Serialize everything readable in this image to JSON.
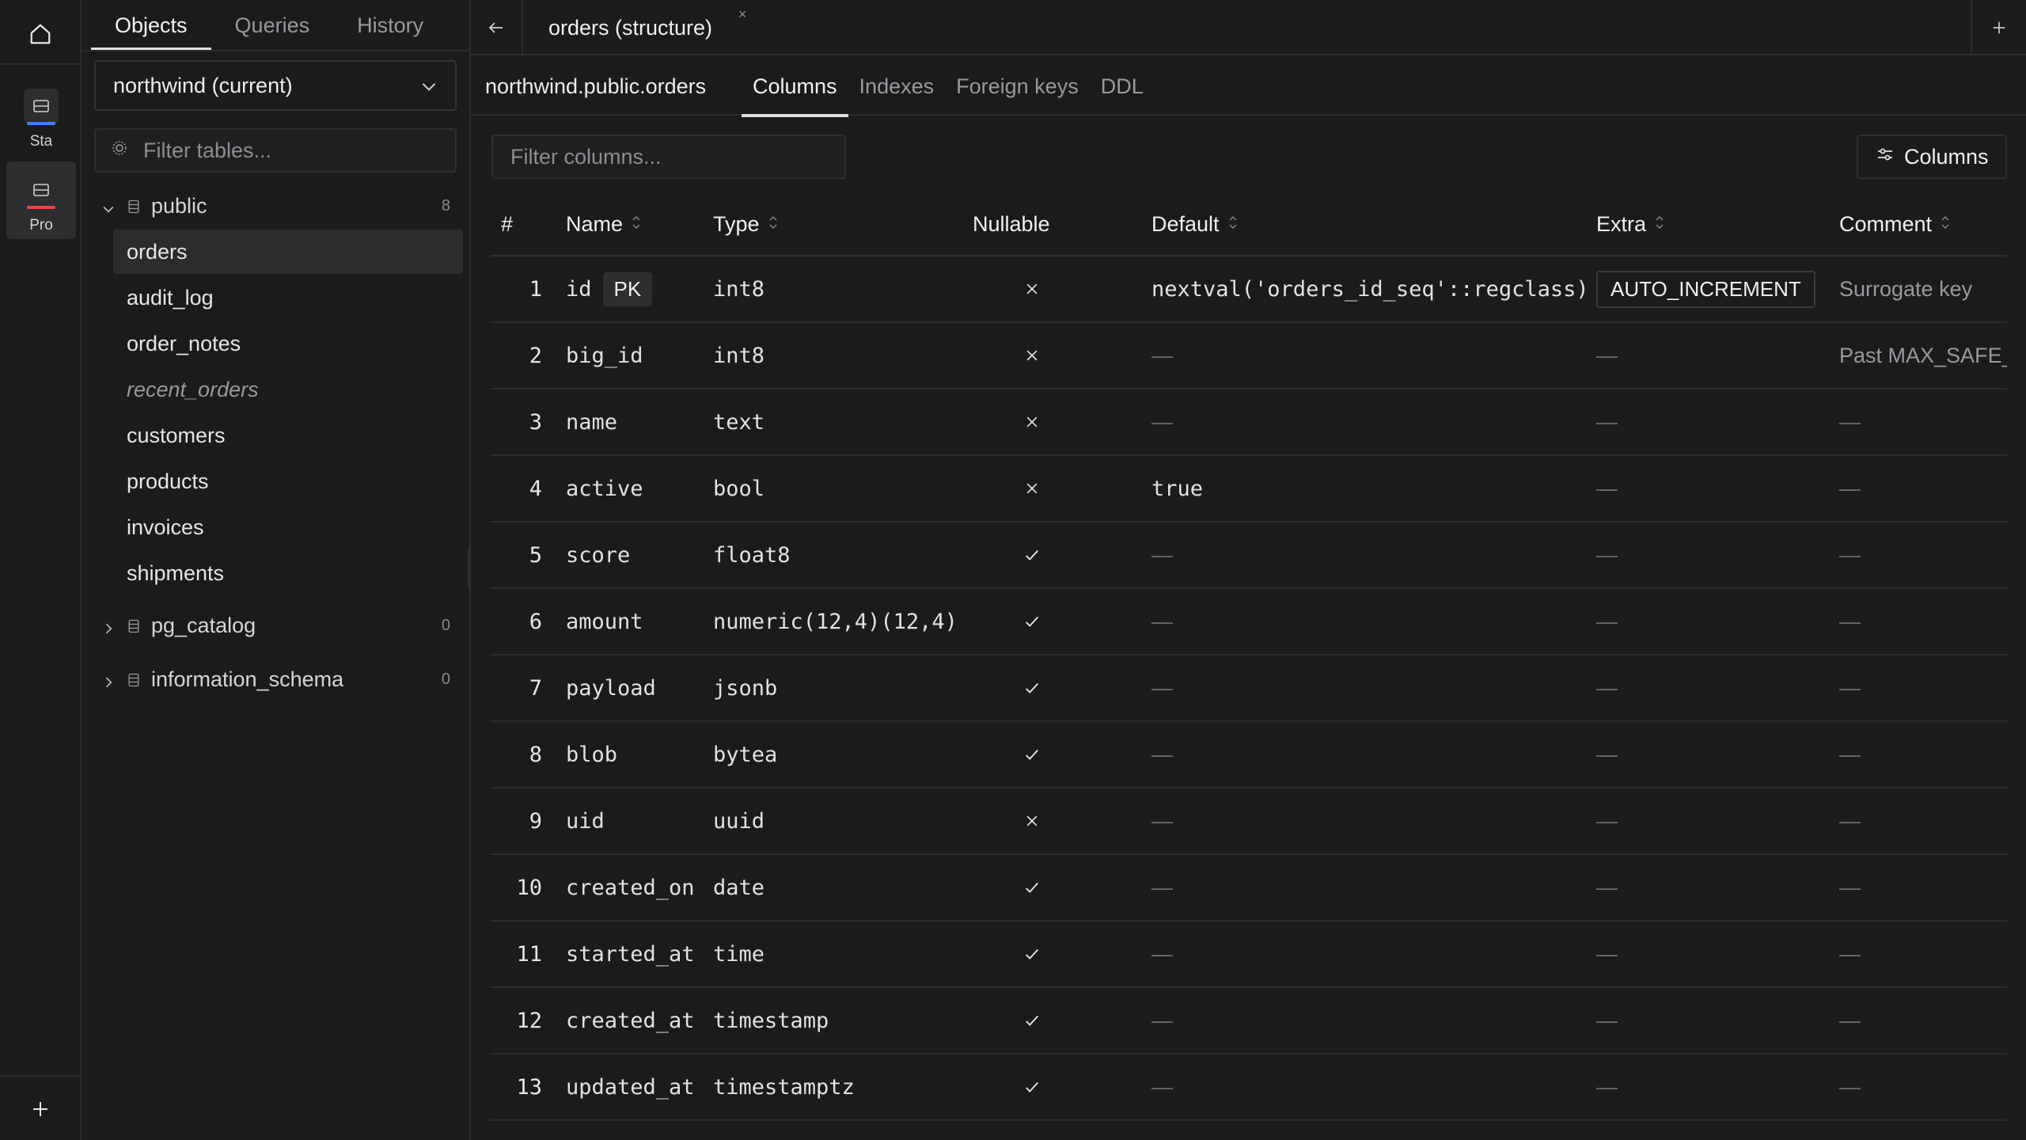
{
  "rail": {
    "connections": [
      {
        "label": "Sta",
        "bar_color": "#3b82f6"
      },
      {
        "label": "Pro",
        "bar_color": "#ef4444"
      }
    ]
  },
  "sidebar": {
    "tabs": [
      "Objects",
      "Queries",
      "History"
    ],
    "active_tab": 0,
    "database": "northwind (current)",
    "filter_placeholder": "Filter tables...",
    "schemas": [
      {
        "name": "public",
        "count": "8",
        "expanded": true,
        "tables": [
          {
            "name": "orders",
            "selected": true,
            "view": false
          },
          {
            "name": "audit_log",
            "selected": false,
            "view": false
          },
          {
            "name": "order_notes",
            "selected": false,
            "view": false
          },
          {
            "name": "recent_orders",
            "selected": false,
            "view": true
          },
          {
            "name": "customers",
            "selected": false,
            "view": false
          },
          {
            "name": "products",
            "selected": false,
            "view": false
          },
          {
            "name": "invoices",
            "selected": false,
            "view": false
          },
          {
            "name": "shipments",
            "selected": false,
            "view": false
          }
        ]
      },
      {
        "name": "pg_catalog",
        "count": "0",
        "expanded": false,
        "tables": []
      },
      {
        "name": "information_schema",
        "count": "0",
        "expanded": false,
        "tables": []
      }
    ]
  },
  "main": {
    "tab_title": "orders (structure)",
    "close_glyph": "×",
    "path": "northwind.public.orders",
    "subtabs": [
      "Columns",
      "Indexes",
      "Foreign keys",
      "DDL"
    ],
    "active_subtab": 0,
    "filter_placeholder": "Filter columns...",
    "columns_button": "Columns",
    "headers": {
      "num": "#",
      "name": "Name",
      "type": "Type",
      "nullable": "Nullable",
      "default": "Default",
      "extra": "Extra",
      "comment": "Comment"
    },
    "pk_label": "PK",
    "rows": [
      {
        "num": "1",
        "name": "id",
        "pk": true,
        "type": "int8",
        "nullable": false,
        "default": "nextval('orders_id_seq'::regclass)",
        "extra": "AUTO_INCREMENT",
        "comment": "Surrogate key"
      },
      {
        "num": "2",
        "name": "big_id",
        "pk": false,
        "type": "int8",
        "nullable": false,
        "default": "—",
        "extra": "—",
        "comment": "Past MAX_SAFE_INTE"
      },
      {
        "num": "3",
        "name": "name",
        "pk": false,
        "type": "text",
        "nullable": false,
        "default": "—",
        "extra": "—",
        "comment": "—"
      },
      {
        "num": "4",
        "name": "active",
        "pk": false,
        "type": "bool",
        "nullable": false,
        "default": "true",
        "extra": "—",
        "comment": "—"
      },
      {
        "num": "5",
        "name": "score",
        "pk": false,
        "type": "float8",
        "nullable": true,
        "default": "—",
        "extra": "—",
        "comment": "—"
      },
      {
        "num": "6",
        "name": "amount",
        "pk": false,
        "type": "numeric(12,4)(12,4)",
        "nullable": true,
        "default": "—",
        "extra": "—",
        "comment": "—"
      },
      {
        "num": "7",
        "name": "payload",
        "pk": false,
        "type": "jsonb",
        "nullable": true,
        "default": "—",
        "extra": "—",
        "comment": "—"
      },
      {
        "num": "8",
        "name": "blob",
        "pk": false,
        "type": "bytea",
        "nullable": true,
        "default": "—",
        "extra": "—",
        "comment": "—"
      },
      {
        "num": "9",
        "name": "uid",
        "pk": false,
        "type": "uuid",
        "nullable": false,
        "default": "—",
        "extra": "—",
        "comment": "—"
      },
      {
        "num": "10",
        "name": "created_on",
        "pk": false,
        "type": "date",
        "nullable": true,
        "default": "—",
        "extra": "—",
        "comment": "—"
      },
      {
        "num": "11",
        "name": "started_at",
        "pk": false,
        "type": "time",
        "nullable": true,
        "default": "—",
        "extra": "—",
        "comment": "—"
      },
      {
        "num": "12",
        "name": "created_at",
        "pk": false,
        "type": "timestamp",
        "nullable": true,
        "default": "—",
        "extra": "—",
        "comment": "—"
      },
      {
        "num": "13",
        "name": "updated_at",
        "pk": false,
        "type": "timestamptz",
        "nullable": true,
        "default": "—",
        "extra": "—",
        "comment": "—"
      }
    ]
  }
}
